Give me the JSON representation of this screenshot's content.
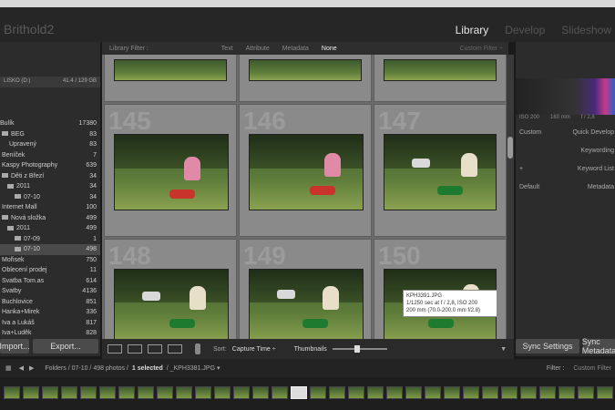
{
  "app": {
    "catalog_name": "Brithold2",
    "modules": [
      "Library",
      "Develop",
      "Slideshow"
    ],
    "active_module": "Library"
  },
  "left_panel": {
    "catalog_header": "LISKO (D:)",
    "catalog_size": "41.4 / 129 GB",
    "folders": [
      {
        "label": "Bulík",
        "count": "17380"
      },
      {
        "label": "BEG",
        "count": "83"
      },
      {
        "label": "Upravený",
        "count": "83"
      },
      {
        "label": "Beníček",
        "count": "7"
      },
      {
        "label": "Kaspy Photography",
        "count": "639"
      },
      {
        "label": "Děti z Březí",
        "count": "34"
      },
      {
        "label": "2011",
        "count": "34"
      },
      {
        "label": "07-10",
        "count": "34"
      },
      {
        "label": "Internet Mall",
        "count": "100"
      },
      {
        "label": "Nová složka",
        "count": "499"
      },
      {
        "label": "2011",
        "count": "499"
      },
      {
        "label": "07-09",
        "count": "1"
      },
      {
        "label": "07-10",
        "count": "498"
      },
      {
        "label": "Mořisek",
        "count": "750"
      },
      {
        "label": "Oblecení prodej",
        "count": "11"
      },
      {
        "label": "Svatba Tom.as",
        "count": "614"
      },
      {
        "label": "Svatby",
        "count": "4136"
      },
      {
        "label": "Buchlovice",
        "count": "851"
      },
      {
        "label": "Hanka+Mirek",
        "count": "336"
      },
      {
        "label": "Iva a Lukáš",
        "count": "817"
      },
      {
        "label": "Iva+Luděk",
        "count": "828"
      }
    ],
    "import_button": "Import...",
    "export_button": "Export..."
  },
  "filter_bar": {
    "label": "Library Filter :",
    "tabs": [
      "Text",
      "Attribute",
      "Metadata",
      "None"
    ],
    "active_tab": "None",
    "custom": "Custom Filter ÷"
  },
  "grid": {
    "cells": [
      "145",
      "146",
      "147",
      "148",
      "149",
      "150"
    ]
  },
  "tooltip": {
    "line1": "KPH3391.JPG",
    "line2": "1/1250 sec at f / 2,8, ISO 200",
    "line3": "200 mm (70.0-200.0 mm f/2.8)"
  },
  "toolbar": {
    "sort_label": "Sort:",
    "sort_value": "Capture Time ÷",
    "thumbnails_label": "Thumbnails"
  },
  "right_panel": {
    "iso": "ISO 200",
    "focal": "160 mm",
    "aperture": "f / 2,8",
    "custom": "Custom",
    "quick_develop": "Quick Develop",
    "keywording": "Keywording",
    "keyword_list": "Keyword List",
    "default": "Default",
    "metadata": "Metadata",
    "sync_settings": "Sync Settings",
    "sync_metadata": "Sync Metadata"
  },
  "filmstrip_header": {
    "path": "Folders / 07-10 / 498 photos /",
    "selected": "1 selected",
    "file": "/ _KPH3381.JPG ▾",
    "filter_label": "Filter :",
    "custom_filter": "Custom Filter"
  }
}
